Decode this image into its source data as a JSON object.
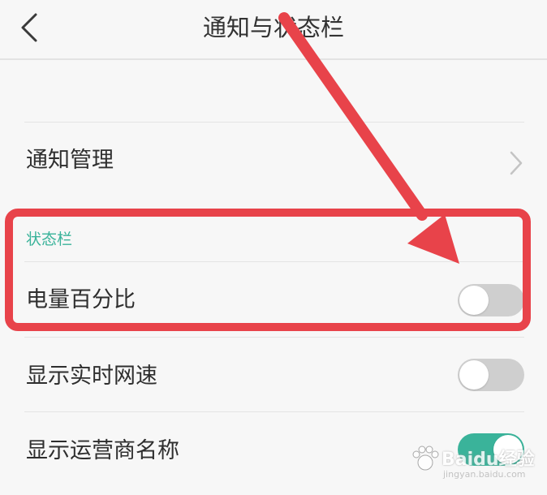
{
  "header": {
    "title": "通知与状态栏",
    "back_icon": "chevron-left-icon"
  },
  "items": {
    "notification_management": {
      "label": "通知管理",
      "icon": "chevron-right-icon"
    }
  },
  "status_bar_section": {
    "header": "状态栏",
    "rows": [
      {
        "label": "电量百分比",
        "toggle_on": false
      },
      {
        "label": "显示实时网速",
        "toggle_on": false
      },
      {
        "label": "显示运营商名称",
        "toggle_on": true
      }
    ]
  },
  "watermark": {
    "brand": "Baidu经验",
    "url": "jingyan.baidu.com"
  },
  "colors": {
    "accent": "#3ab39a",
    "annotation_red": "#e8434a",
    "toggle_off": "#cfcfcf",
    "background": "#f7f7f7"
  }
}
